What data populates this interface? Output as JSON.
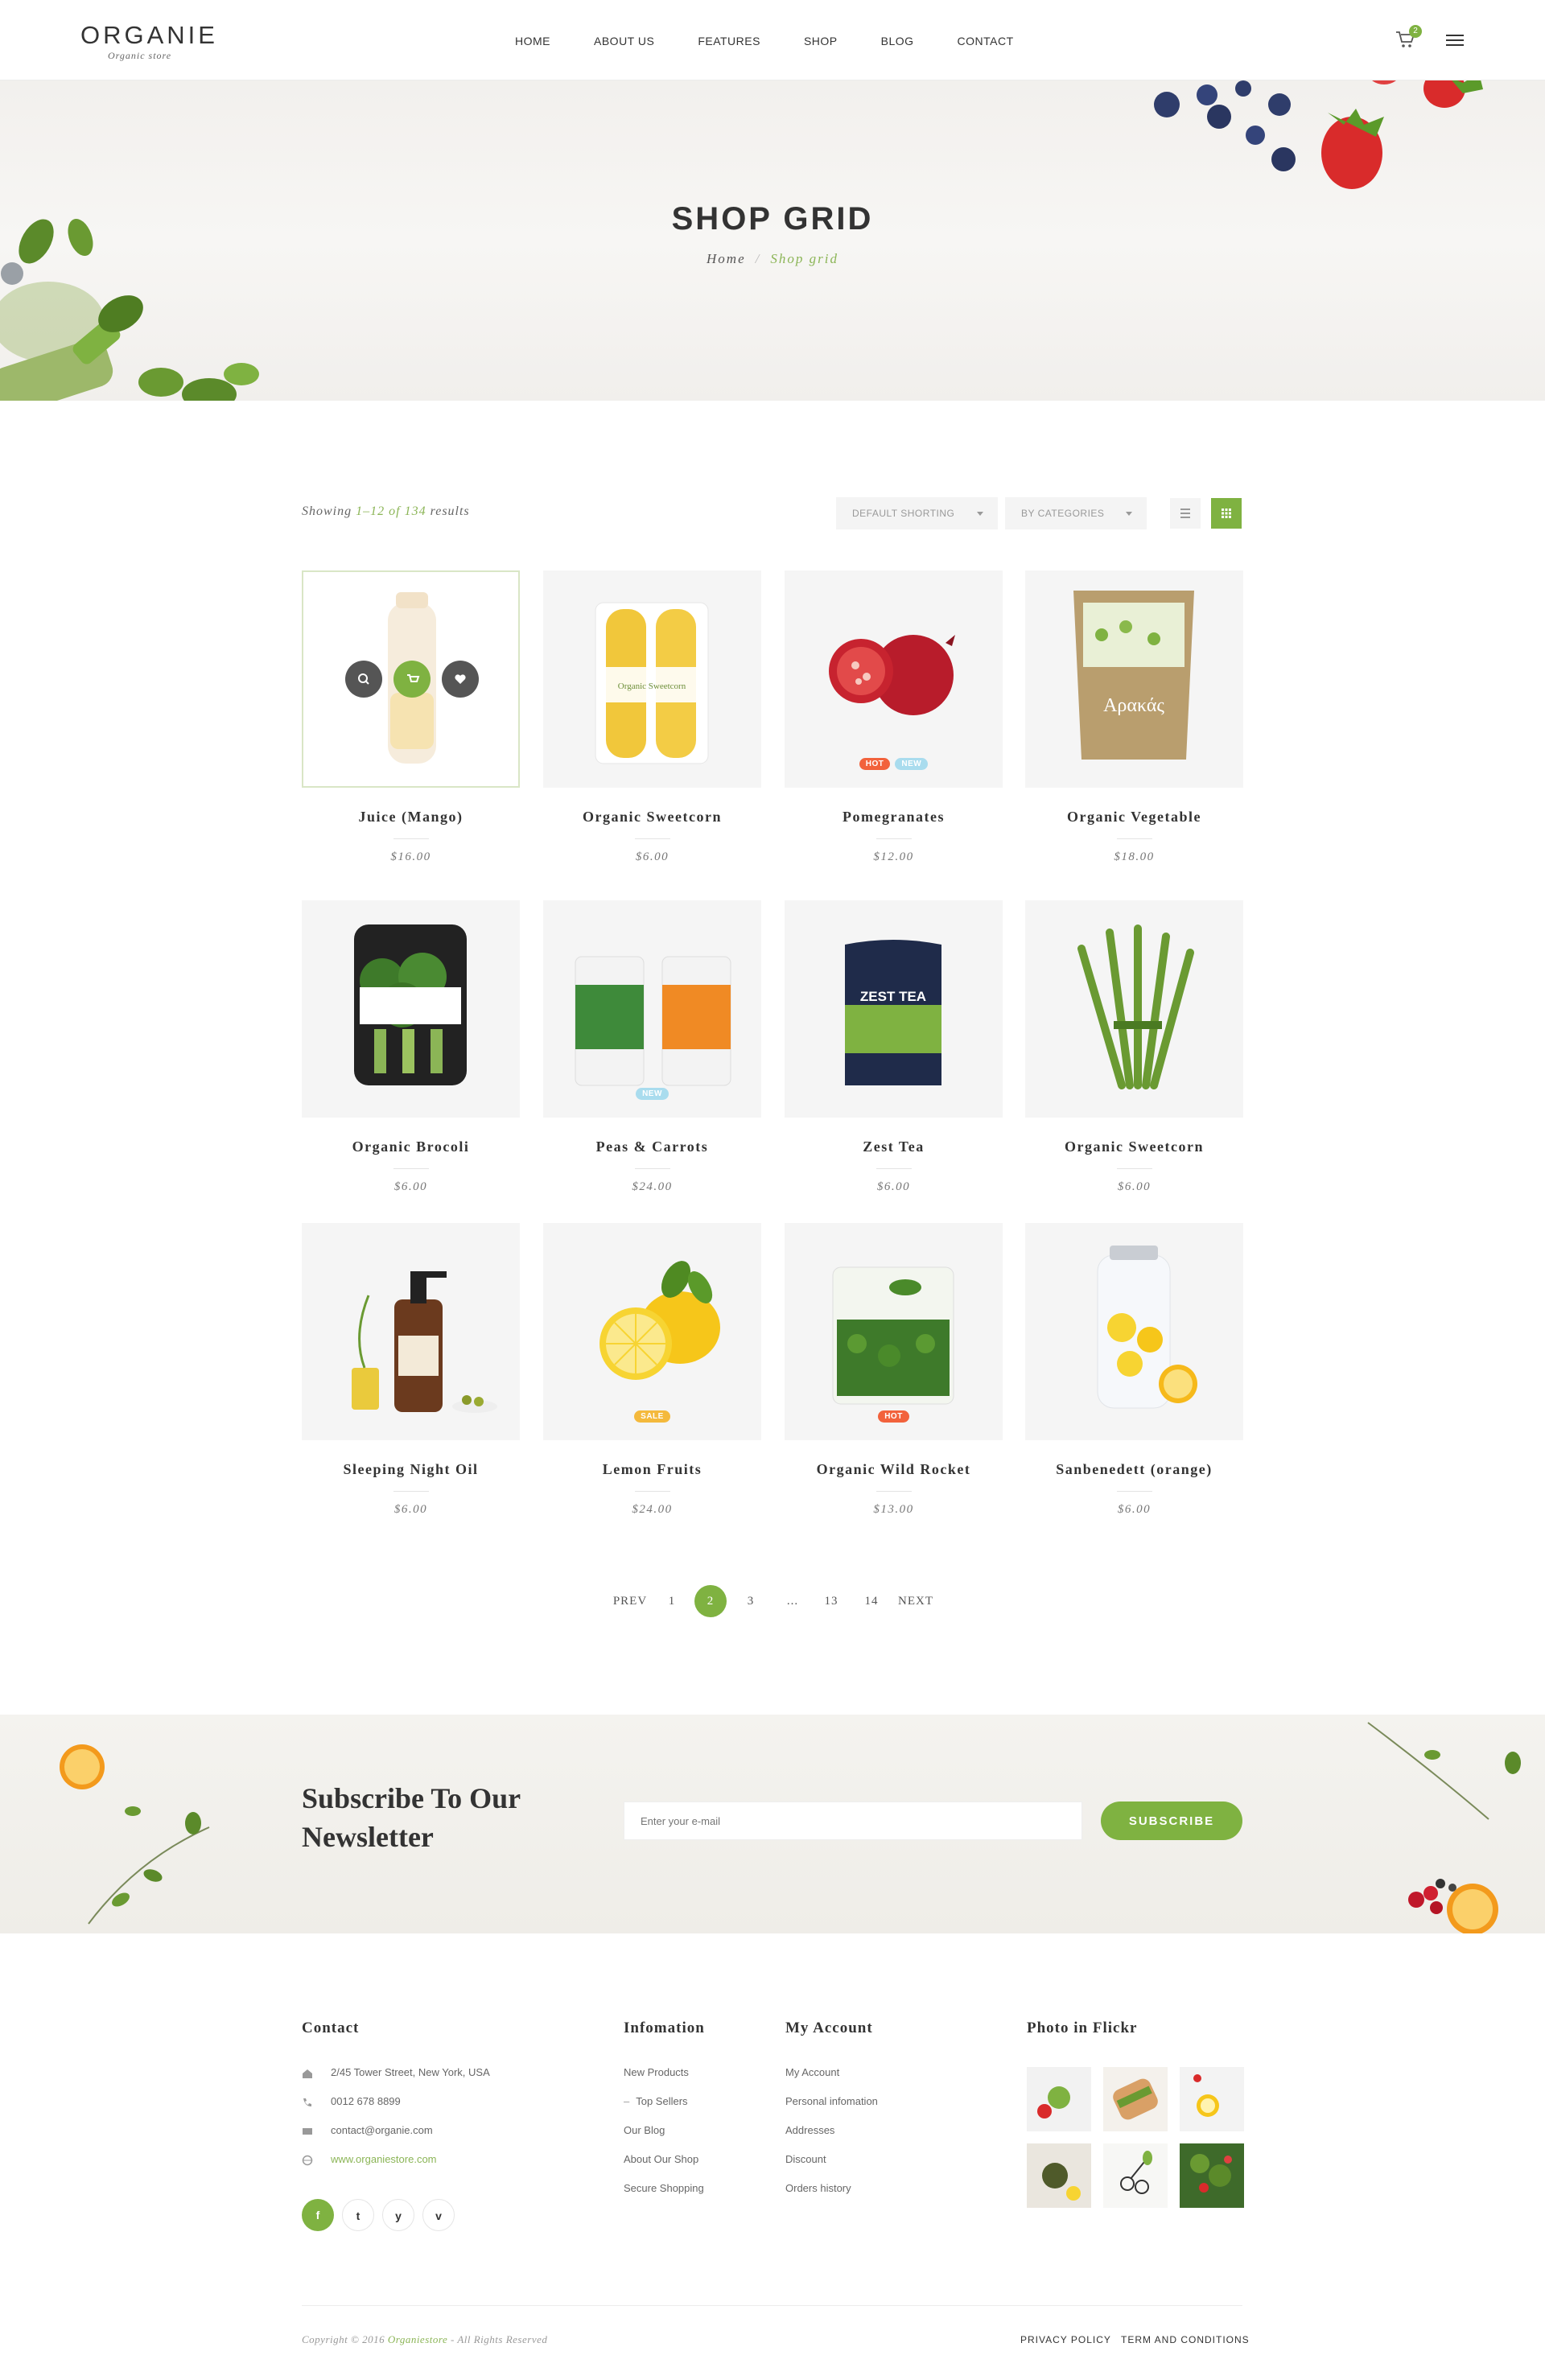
{
  "header": {
    "logo": "ORGANIE",
    "tagline": "Organic store",
    "nav": [
      "HOME",
      "ABOUT US",
      "FEATURES",
      "SHOP",
      "BLOG",
      "CONTACT"
    ],
    "cart_count": "2"
  },
  "hero": {
    "title": "SHOP GRID",
    "breadcrumb": [
      "Home",
      "Shop grid"
    ]
  },
  "toolbar": {
    "results": [
      "Showing ",
      "1–12 of 134",
      " results"
    ],
    "sort": "DEFAULT SHORTING",
    "category": "BY CATEGORIES"
  },
  "products": [
    {
      "name": "Juice (Mango)",
      "price": "$16.00",
      "badges": []
    },
    {
      "name": "Organic Sweetcorn",
      "price": "$6.00",
      "badges": []
    },
    {
      "name": "Pomegranates",
      "price": "$12.00",
      "badges": [
        "HOT",
        "NEW"
      ]
    },
    {
      "name": "Organic Vegetable",
      "price": "$18.00",
      "badges": []
    },
    {
      "name": "Organic Brocoli",
      "price": "$6.00",
      "badges": []
    },
    {
      "name": "Peas & Carrots",
      "price": "$24.00",
      "badges": [
        "NEW"
      ]
    },
    {
      "name": "Zest Tea",
      "price": "$6.00",
      "badges": []
    },
    {
      "name": "Organic Sweetcorn",
      "price": "$6.00",
      "badges": []
    },
    {
      "name": "Sleeping Night Oil",
      "price": "$6.00",
      "badges": []
    },
    {
      "name": "Lemon Fruits",
      "price": "$24.00",
      "badges": [
        "SALE"
      ]
    },
    {
      "name": "Organic Wild Rocket",
      "price": "$13.00",
      "badges": [
        "HOT"
      ]
    },
    {
      "name": "Sanbenedett (orange)",
      "price": "$6.00",
      "badges": []
    }
  ],
  "product_art": {
    "sweetcorn_label": "Organic Sweetcorn",
    "vegetable_label": "Αρακάς",
    "tea_label": "ZEST TEA"
  },
  "pagination": [
    "PREV",
    "1",
    "2",
    "3",
    "...",
    "13",
    "14",
    "NEXT"
  ],
  "pagination_active": "2",
  "newsletter": {
    "title": "Subscribe To Our Newsletter",
    "placeholder": "Enter your e-mail",
    "button": "SUBSCRIBE"
  },
  "footer": {
    "contact_title": "Contact",
    "contact": [
      {
        "icon": "home-icon",
        "text": "2/45 Tower Street, New York, USA"
      },
      {
        "icon": "phone-icon",
        "text": "0012 678 8899"
      },
      {
        "icon": "mail-icon",
        "text": "contact@organie.com"
      },
      {
        "icon": "globe-icon",
        "text": "www.organiestore.com"
      }
    ],
    "info_title": "Infomation",
    "info_links": [
      "New Products",
      "Top Sellers",
      "Our Blog",
      "About Our Shop",
      "Secure Shopping"
    ],
    "account_title": "My Account",
    "account_links": [
      "My Account",
      "Personal infomation",
      "Addresses",
      "Discount",
      "Orders history"
    ],
    "flickr_title": "Photo in Flickr",
    "social": [
      "f",
      "t",
      "y",
      "v"
    ],
    "copyright": [
      "Copyright © 2016 ",
      "Organiestore",
      " - All Rights Reserved"
    ],
    "legal": [
      "PRIVACY POLICY",
      "TERM AND CONDITIONS"
    ]
  },
  "colors": {
    "accent": "#7fb241",
    "hot": "#f2623c",
    "new": "#a9dcee",
    "sale": "#f4b93c"
  }
}
